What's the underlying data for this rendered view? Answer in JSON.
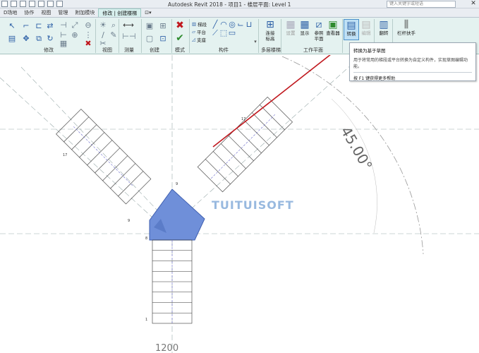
{
  "app": {
    "title": "Autodesk Revit 2018 -    项目1 - 楼层平面: Level 1",
    "search_placeholder": "键入关键字或短语"
  },
  "tabs": [
    "D场地",
    "协作",
    "视图",
    "管理",
    "附加模块",
    "修改 | 创建楼梯"
  ],
  "ribbon": {
    "groups": [
      "修改",
      "视图",
      "测量",
      "创建",
      "模式",
      "构件",
      "多层楼梯",
      "工作平面"
    ],
    "component": {
      "stair_run": "梯段",
      "landing": "平台",
      "support": "支座"
    },
    "multistory": {
      "connect_levels_l1": "连接",
      "connect_levels_l2": "标高"
    },
    "workplane": {
      "set": "设置",
      "show": "显示",
      "ref_plane_l1": "参照",
      "ref_plane_l2": "平面",
      "viewer": "查看器"
    },
    "convert": "转换",
    "edit_sketch": "编辑",
    "flip": "翻转",
    "railing": "栏杆扶手"
  },
  "tooltip": {
    "title": "转换为基于草图",
    "description": "用于将常用的梯段或平台转换为自定义构件，实现草图编辑功能。",
    "help": "按 F1 键获得更多帮助"
  },
  "canvas": {
    "angle_label": "45.00°",
    "watermark": "TUITUISOFT",
    "bottom_dimension": "1200",
    "riser_numbers": [
      "17",
      "17",
      "9",
      "9",
      "8",
      "1"
    ]
  },
  "colors": {
    "ribbon_bg": "#e4f2f0",
    "landing_fill": "#6f8fd9",
    "arrow": "#c0181e",
    "highlight": "#bfe0f5"
  }
}
